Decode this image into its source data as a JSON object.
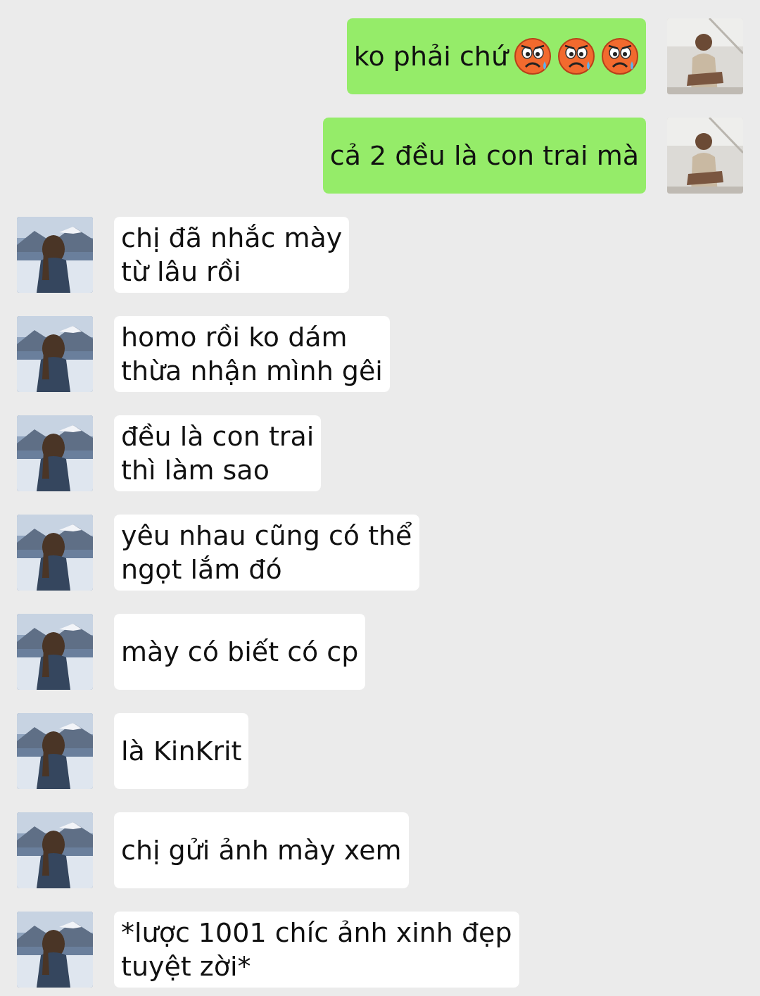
{
  "messages": [
    {
      "kind": "sent",
      "text": "ko phải chứ",
      "emojis": [
        {
          "kind": "crying-angry"
        },
        {
          "kind": "crying-angry"
        },
        {
          "kind": "crying-angry"
        }
      ]
    },
    {
      "kind": "sent",
      "text": "cả 2 đều là con trai mà"
    },
    {
      "kind": "received",
      "text": "chị đã nhắc mày\ntừ lâu rồi"
    },
    {
      "kind": "received",
      "text": "homo rồi ko dám\nthừa nhận mình gêi"
    },
    {
      "kind": "received",
      "text": "đều là con trai\nthì làm sao"
    },
    {
      "kind": "received",
      "text": "yêu nhau cũng có thể\nngọt lắm đó"
    },
    {
      "kind": "received",
      "text": "mày có biết có cp"
    },
    {
      "kind": "received",
      "text": "là KinKrit"
    },
    {
      "kind": "received",
      "text": "chị gửi ảnh mày xem"
    },
    {
      "kind": "received",
      "text": "*lược 1001 chíc ảnh xinh đẹp\ntuyệt zời*"
    }
  ]
}
